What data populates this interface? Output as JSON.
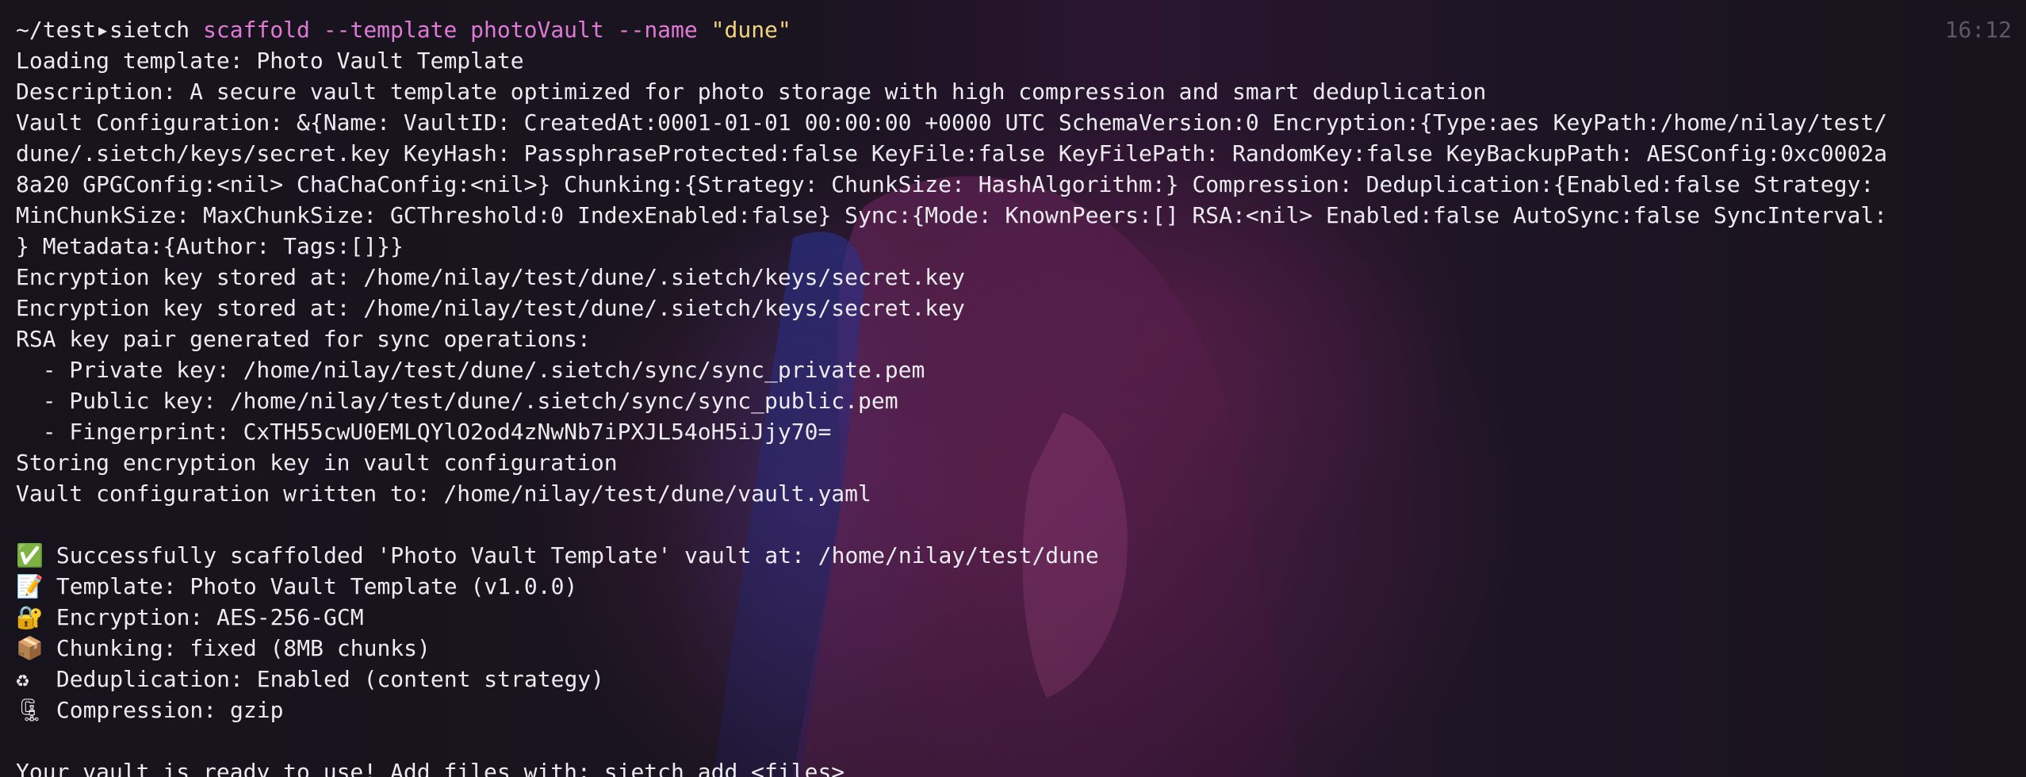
{
  "prompt": {
    "path": "~/test",
    "arrow": "▸",
    "command": "sietch",
    "args": " scaffold --template photoVault --name ",
    "name_arg": "\"dune\"",
    "time": "16:12"
  },
  "output": [
    "Loading template: Photo Vault Template",
    "Description: A secure vault template optimized for photo storage with high compression and smart deduplication",
    "Vault Configuration: &{Name: VaultID: CreatedAt:0001-01-01 00:00:00 +0000 UTC SchemaVersion:0 Encryption:{Type:aes KeyPath:/home/nilay/test/",
    "dune/.sietch/keys/secret.key KeyHash: PassphraseProtected:false KeyFile:false KeyFilePath: RandomKey:false KeyBackupPath: AESConfig:0xc0002a",
    "8a20 GPGConfig:<nil> ChaChaConfig:<nil>} Chunking:{Strategy: ChunkSize: HashAlgorithm:} Compression: Deduplication:{Enabled:false Strategy:",
    "MinChunkSize: MaxChunkSize: GCThreshold:0 IndexEnabled:false} Sync:{Mode: KnownPeers:[] RSA:<nil> Enabled:false AutoSync:false SyncInterval:",
    "} Metadata:{Author: Tags:[]}}",
    "Encryption key stored at: /home/nilay/test/dune/.sietch/keys/secret.key",
    "Encryption key stored at: /home/nilay/test/dune/.sietch/keys/secret.key",
    "RSA key pair generated for sync operations:",
    "  - Private key: /home/nilay/test/dune/.sietch/sync/sync_private.pem",
    "  - Public key: /home/nilay/test/dune/.sietch/sync/sync_public.pem",
    "  - Fingerprint: CxTH55cwU0EMLQYlO2od4zNwNb7iPXJL54oH5iJjy70=",
    "Storing encryption key in vault configuration",
    "Vault configuration written to: /home/nilay/test/dune/vault.yaml",
    ""
  ],
  "summary": [
    {
      "icon": "✅",
      "icon_name": "checkmark-icon",
      "text": "Successfully scaffolded 'Photo Vault Template' vault at: /home/nilay/test/dune"
    },
    {
      "icon": "📝",
      "icon_name": "memo-icon",
      "text": "Template: Photo Vault Template (v1.0.0)"
    },
    {
      "icon": "🔐",
      "icon_name": "lock-key-icon",
      "text": "Encryption: AES-256-GCM"
    },
    {
      "icon": "📦",
      "icon_name": "package-icon",
      "text": "Chunking: fixed (8MB chunks)"
    },
    {
      "icon": "♻",
      "icon_name": "recycle-icon",
      "text": "Deduplication: Enabled (content strategy)"
    },
    {
      "icon": "🗜",
      "icon_name": "clamp-icon",
      "text": "Compression: gzip"
    }
  ],
  "footer": [
    "",
    "Your vault is ready to use! Add files with: sietch add <files>"
  ],
  "colors": {
    "foreground": "#ecebf0",
    "argument": "#e07ad6",
    "string": "#f2d57a",
    "clock": "#5d5866"
  }
}
